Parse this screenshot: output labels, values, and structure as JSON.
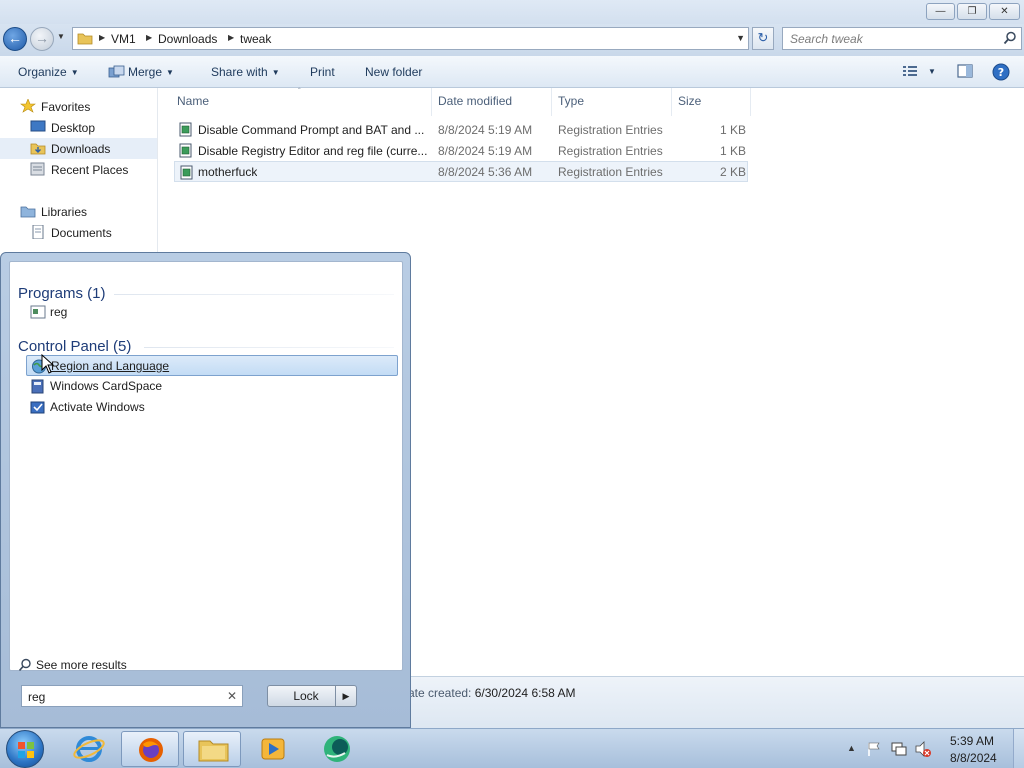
{
  "address": {
    "crumbs": [
      "VM1",
      "Downloads",
      "tweak"
    ],
    "search_placeholder": "Search tweak"
  },
  "toolbar": {
    "organize": "Organize",
    "merge": "Merge",
    "share_with": "Share with",
    "print": "Print",
    "new_folder": "New folder"
  },
  "nav": {
    "favorites": "Favorites",
    "desktop": "Desktop",
    "downloads": "Downloads",
    "recent_places": "Recent Places",
    "libraries": "Libraries",
    "documents": "Documents"
  },
  "columns": {
    "name": "Name",
    "date_modified": "Date modified",
    "type": "Type",
    "size": "Size"
  },
  "files": [
    {
      "name": "Disable Command Prompt and BAT and ...",
      "date": "8/8/2024 5:19 AM",
      "type": "Registration Entries",
      "size": "1 KB"
    },
    {
      "name": "Disable Registry Editor and reg file (curre...",
      "date": "8/8/2024 5:19 AM",
      "type": "Registration Entries",
      "size": "1 KB"
    },
    {
      "name": "motherfuck",
      "date": "8/8/2024 5:36 AM",
      "type": "Registration Entries",
      "size": "2 KB"
    }
  ],
  "details": {
    "created_label": "ate created:",
    "created_value": "6/30/2024 6:58 AM"
  },
  "start_menu": {
    "programs_header": "Programs (1)",
    "programs": [
      "reg"
    ],
    "control_panel_header": "Control Panel (5)",
    "control_panel": [
      "Region and Language",
      "Windows CardSpace",
      "Activate Windows"
    ],
    "see_more": "See more results",
    "search_value": "reg",
    "lock_label": "Lock"
  },
  "taskbar": {
    "time": "5:39 AM",
    "date": "8/8/2024"
  },
  "colors": {
    "accent": "#1e3c78",
    "highlight": "#c3dcf5",
    "taskbar": "#a7bfdb"
  }
}
